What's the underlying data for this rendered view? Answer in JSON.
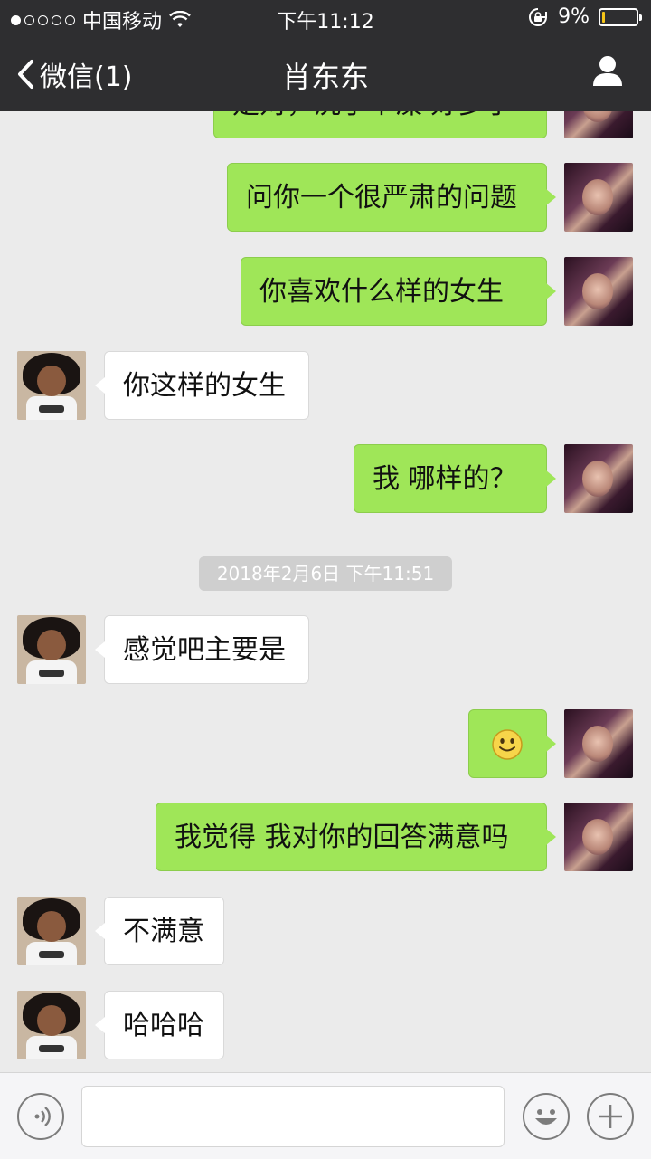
{
  "status_bar": {
    "carrier": "中国移动",
    "time": "下午11:12",
    "battery": "9%",
    "battery_level": 0.09
  },
  "nav": {
    "back_label": "微信(1)",
    "title": "肖东东"
  },
  "chat": {
    "partial_top_text": "是对，洗了个澡 好多了",
    "messages": [
      {
        "text": "问你一个很严肃的问题"
      },
      {
        "text": "你喜欢什么样的女生"
      },
      {
        "text": "你这样的女生"
      },
      {
        "text": "我 哪样的？"
      },
      {
        "text": "感觉吧主要是"
      },
      {
        "emoji": "smile-emoji"
      },
      {
        "text": "我觉得 我对你的回答满意吗"
      },
      {
        "text": "不满意"
      },
      {
        "text": "哈哈哈"
      }
    ],
    "timestamp": "2018年2月6日 下午11:51"
  },
  "input_bar": {
    "voice_icon": "voice-icon",
    "emoji_icon": "emoji-icon",
    "plus_icon": "plus-icon"
  },
  "colors": {
    "bar_bg": "#2e2e30",
    "chat_bg": "#ebebeb",
    "my_bubble": "#9fe658",
    "other_bubble": "#ffffff",
    "battery_fill": "#f5c518"
  }
}
